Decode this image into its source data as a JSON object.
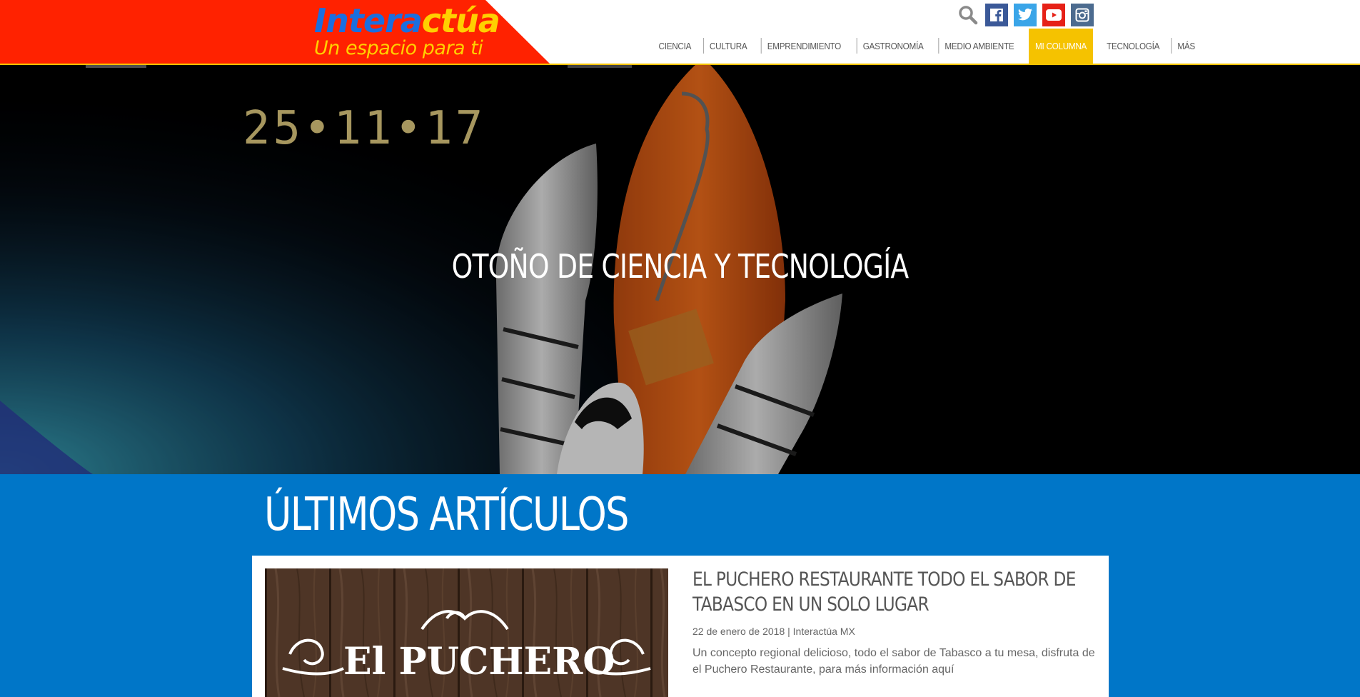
{
  "header": {
    "logo": {
      "word_part1": "Intera",
      "word_part2": "ctúa",
      "tagline": "Un espacio para ti"
    },
    "icons": [
      "search-icon",
      "facebook-icon",
      "twitter-icon",
      "youtube-icon",
      "instagram-icon"
    ],
    "nav": [
      {
        "label": "CIENCIA"
      },
      {
        "label": "CULTURA"
      },
      {
        "label": "EMPRENDIMIENTO"
      },
      {
        "label": "GASTRONOMÍA"
      },
      {
        "label": "MEDIO AMBIENTE"
      },
      {
        "label": "MI COLUMNA"
      },
      {
        "label": "TECNOLOGÍA"
      },
      {
        "label": "MÁS"
      }
    ],
    "active_nav": "MI COLUMNA"
  },
  "hero": {
    "date_text": "25•11•17",
    "title": "OTOÑO DE CIENCIA Y TECNOLOGÍA"
  },
  "latest": {
    "heading": "ÚLTIMOS ARTÍCULOS",
    "articles": [
      {
        "title": "EL PUCHERO RESTAURANTE TODO EL SABOR DE TABASCO EN UN SOLO LUGAR",
        "meta": "22 de enero de 2018 | Interactúa MX",
        "excerpt": "Un concepto regional delicioso, todo el sabor de Tabasco a tu mesa, disfruta de el Puchero Restaurante, para más información aquí",
        "image_text": "El PUCHERO"
      }
    ]
  },
  "colors": {
    "brand_red": "#ff2200",
    "brand_yellow": "#f5c200",
    "section_blue": "#0076c8",
    "logo_blue": "#1a6fe0"
  }
}
